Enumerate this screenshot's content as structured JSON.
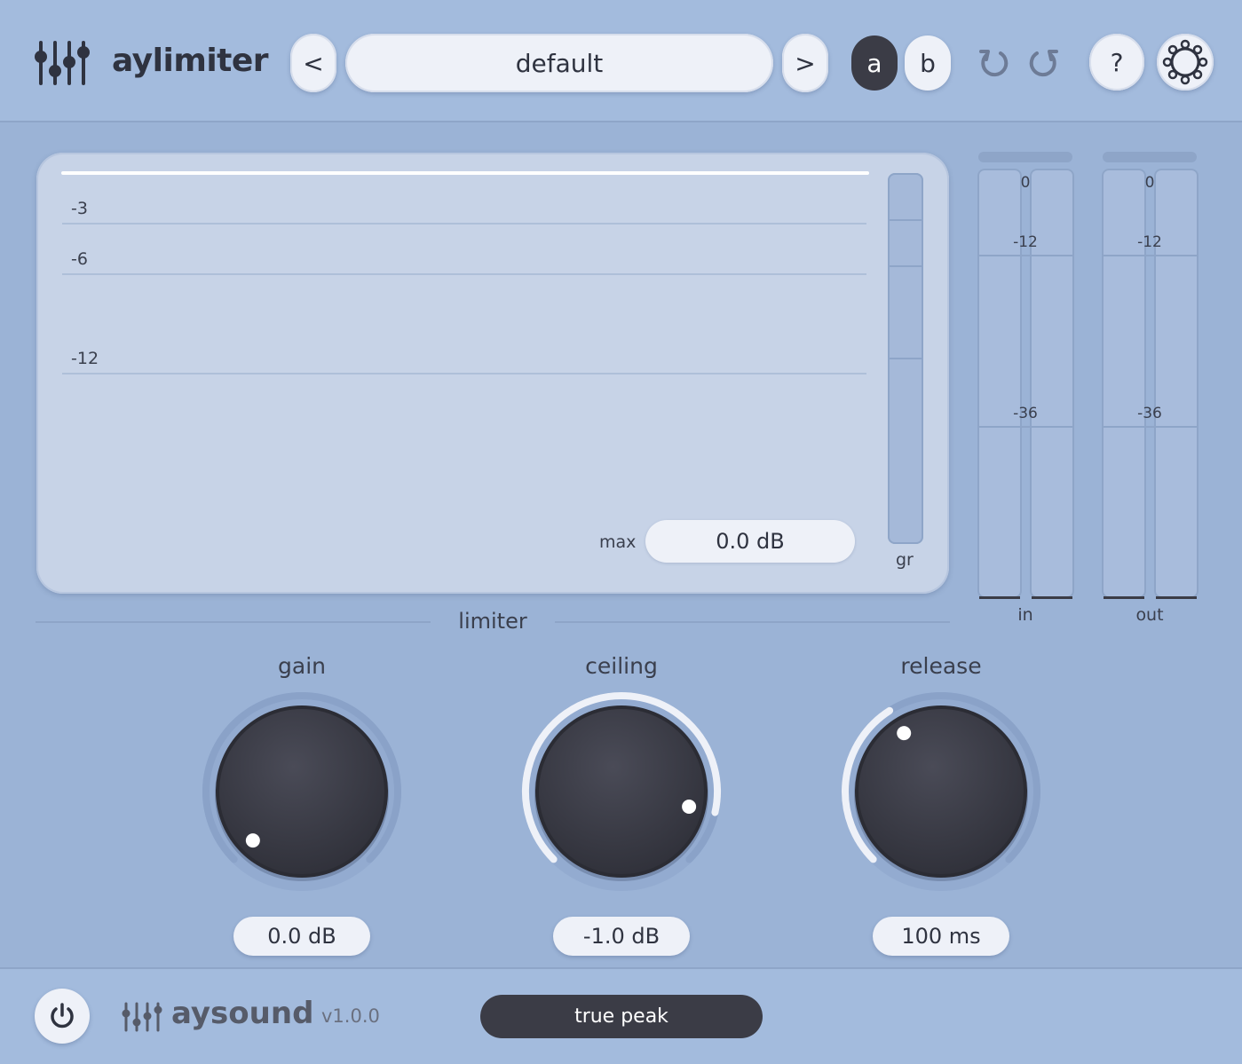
{
  "header": {
    "app_name": "aylimiter",
    "prev_label": "<",
    "preset_name": "default",
    "next_label": ">",
    "ab_a": "a",
    "ab_b": "b",
    "help_label": "?"
  },
  "graph": {
    "grid_labels": [
      "-3",
      "-6",
      "-12"
    ],
    "max_label": "max",
    "max_value": "0.0 dB",
    "gr_label": "gr"
  },
  "meters": {
    "in": {
      "label": "in",
      "scale": [
        "0",
        "-12",
        "-36"
      ]
    },
    "out": {
      "label": "out",
      "scale": [
        "0",
        "-12",
        "-36"
      ]
    }
  },
  "section": {
    "title": "limiter"
  },
  "knobs": [
    {
      "label": "gain",
      "value": "0.0 dB",
      "level": 0.0
    },
    {
      "label": "ceiling",
      "value": "-1.0 dB",
      "level": 0.88
    },
    {
      "label": "release",
      "value": "100 ms",
      "level": 0.38
    }
  ],
  "footer": {
    "brand": "aysound",
    "version": "v1.0.0",
    "true_peak_label": "true peak"
  },
  "colors": {
    "background": "#9bb3d6",
    "panel": "#c7d3e7",
    "dark": "#3b3c46",
    "pill": "#eef1f8"
  }
}
